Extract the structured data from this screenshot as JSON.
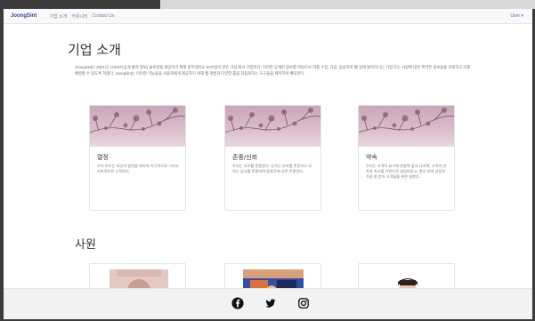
{
  "navbar": {
    "brand": "JoongSint",
    "links": [
      "기업 소개",
      "커뮤니티",
      "Contact Us"
    ],
    "user_menu": "User ▾"
  },
  "about": {
    "title": "기업 소개",
    "intro": "JoongSint는 2021년, OSINT(공개 출처 정보) 솔루션을 제공하기 위해 중부대학교 SOF팀이 만든 가상 회사 기업이다. 이러한 공개된 정보를 바탕으로 이를 수집, 가공, 응용하여 웹 상에 돌아다니는 기업 또는 사람에 대한 취약한 정보들을 조회하고 이를 예방할 수 있도록 하였다. Joongsint는 이러한 기능들을 사용자에게 제공하기 위해 웹 개발과 다양한 툴을 자동화하는 도구들을 제작하여 배포한다.",
    "cards": [
      {
        "title": "열정",
        "text": "우리 모두는 자신의 발전을 위하여 적극적으로 그리고 지속적으로 노력한다."
      },
      {
        "title": "존중/신뢰",
        "text": "우리는 서로를 존중한다. 상사는 부하를 존중하고 부하는 상사를 존중하며 동료간에 서로 존중한다."
      },
      {
        "title": "약속",
        "text": "우리는 고객의 요구에 한발짝 앞서 나가며, 고객의 만족과 최고를 기반으로 설립되었고, 항상 미래 성장의 가장 중 받아 고객들을 위한 일한다."
      }
    ]
  },
  "staff": {
    "title": "사원"
  },
  "footer": {
    "icons": [
      "facebook-icon",
      "twitter-icon",
      "instagram-icon"
    ]
  },
  "colors": {
    "brand": "#3b4a8c",
    "navbar_bg": "#f8f9fa",
    "footer_bg": "#f2f2f2",
    "card_image_tint": "#d9bccb"
  }
}
